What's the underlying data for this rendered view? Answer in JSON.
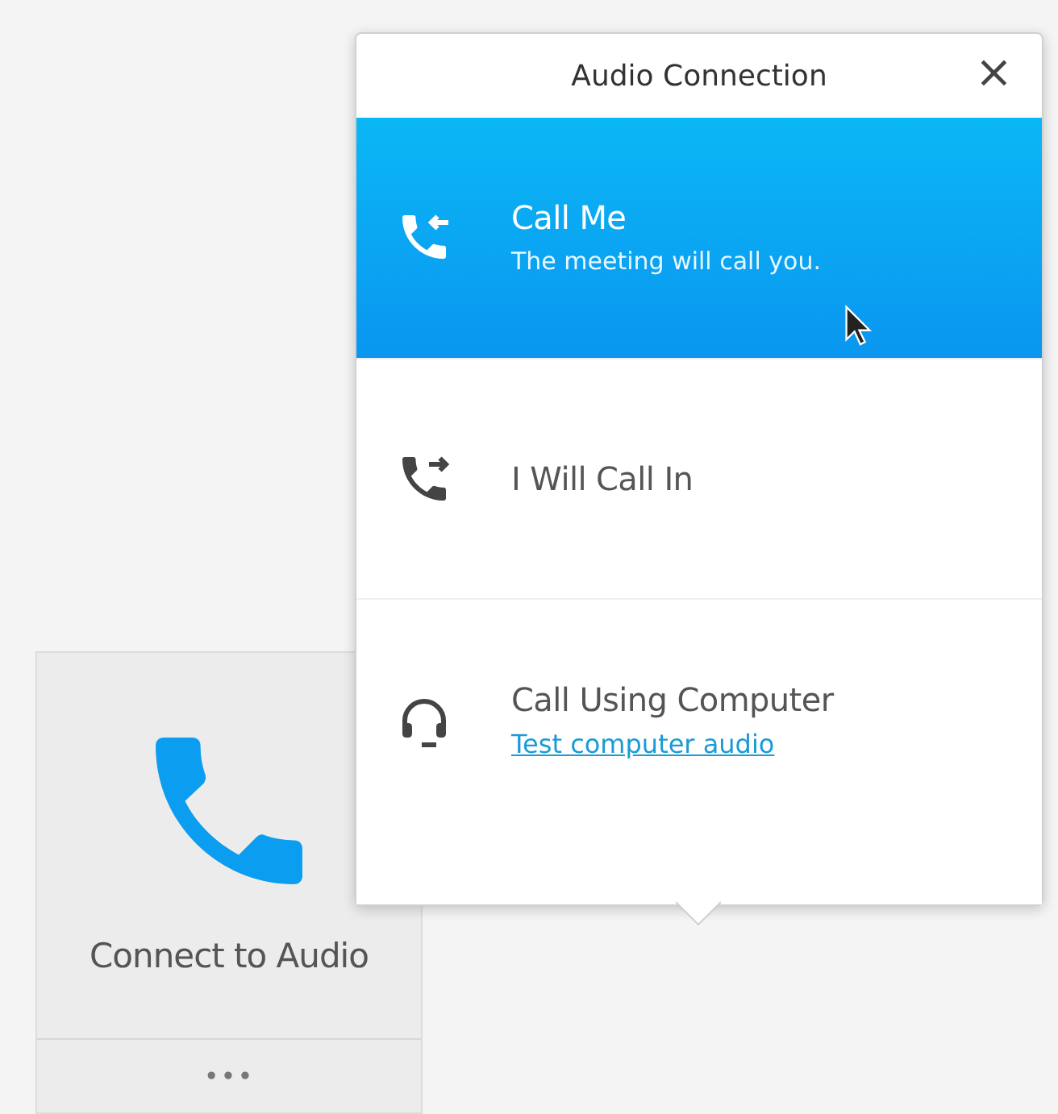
{
  "tile": {
    "label": "Connect to Audio",
    "more": "•••"
  },
  "popup": {
    "title": "Audio Connection",
    "close": "×",
    "options": [
      {
        "kind": "callback",
        "title": "Call Me",
        "subtitle": "The meeting will call you.",
        "selected": true
      },
      {
        "kind": "dialin",
        "title": "I Will Call In",
        "selected": false
      },
      {
        "kind": "computer",
        "title": "Call Using Computer",
        "link": "Test computer audio",
        "selected": false
      }
    ]
  }
}
